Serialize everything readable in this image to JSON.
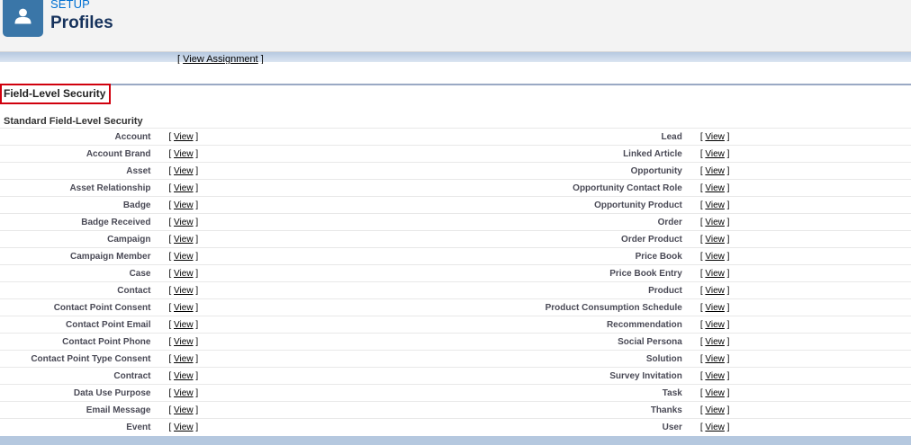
{
  "header": {
    "setup_label": "SETUP",
    "title": "Profiles",
    "icon": "user-icon"
  },
  "previous_link": {
    "text": "View Assignment"
  },
  "section": {
    "title": "Field-Level Security",
    "subtitle": "Standard Field-Level Security",
    "view_label": "View",
    "rows": [
      {
        "left": "Account",
        "right": "Lead"
      },
      {
        "left": "Account Brand",
        "right": "Linked Article"
      },
      {
        "left": "Asset",
        "right": "Opportunity"
      },
      {
        "left": "Asset Relationship",
        "right": "Opportunity Contact Role"
      },
      {
        "left": "Badge",
        "right": "Opportunity Product"
      },
      {
        "left": "Badge Received",
        "right": "Order"
      },
      {
        "left": "Campaign",
        "right": "Order Product"
      },
      {
        "left": "Campaign Member",
        "right": "Price Book"
      },
      {
        "left": "Case",
        "right": "Price Book Entry"
      },
      {
        "left": "Contact",
        "right": "Product"
      },
      {
        "left": "Contact Point Consent",
        "right": "Product Consumption Schedule"
      },
      {
        "left": "Contact Point Email",
        "right": "Recommendation"
      },
      {
        "left": "Contact Point Phone",
        "right": "Social Persona"
      },
      {
        "left": "Contact Point Type Consent",
        "right": "Solution"
      },
      {
        "left": "Contract",
        "right": "Survey Invitation"
      },
      {
        "left": "Data Use Purpose",
        "right": "Task"
      },
      {
        "left": "Email Message",
        "right": "Thanks"
      },
      {
        "left": "Event",
        "right": "User"
      }
    ]
  },
  "colors": {
    "header_bg": "#f3f3f3",
    "icon_bg": "#3a76a8",
    "accent_link": "#0070d2",
    "highlight_border": "#d0000d"
  }
}
